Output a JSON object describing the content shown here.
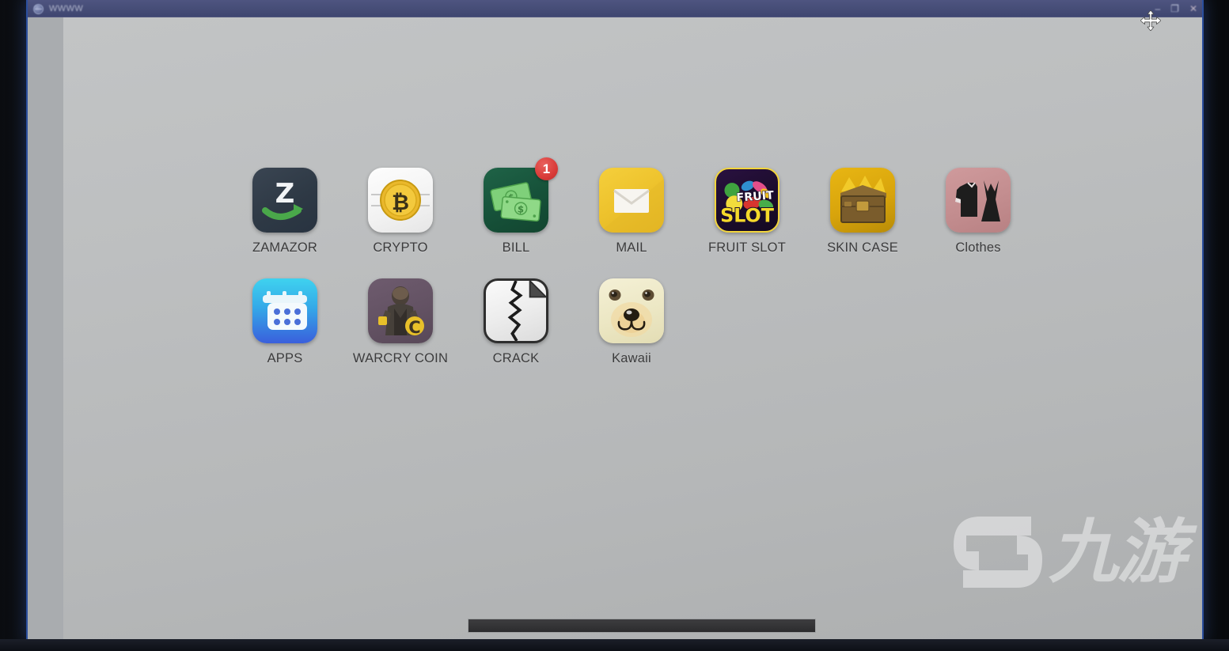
{
  "window": {
    "title": "WWWW",
    "favicon": "browser-globe-icon",
    "controls": {
      "minimize": "–",
      "maximize": "❐",
      "close": "✕"
    }
  },
  "cursor": {
    "type": "move-cursor"
  },
  "desktop": {
    "apps": [
      {
        "id": "zamazor",
        "label": "ZAMAZOR",
        "icon": "zamazor-icon",
        "badge": null
      },
      {
        "id": "crypto",
        "label": "CRYPTO",
        "icon": "crypto-icon",
        "badge": null
      },
      {
        "id": "bill",
        "label": "BILL",
        "icon": "bill-icon",
        "badge": "1"
      },
      {
        "id": "mail",
        "label": "MAIL",
        "icon": "mail-icon",
        "badge": null
      },
      {
        "id": "fruit-slot",
        "label": "FRUIT SLOT",
        "icon": "fruit-slot-icon",
        "badge": null
      },
      {
        "id": "skin-case",
        "label": "SKIN CASE",
        "icon": "skin-case-icon",
        "badge": null
      },
      {
        "id": "clothes",
        "label": "Clothes",
        "icon": "clothes-icon",
        "badge": null
      },
      {
        "id": "apps",
        "label": "APPS",
        "icon": "apps-icon",
        "badge": null
      },
      {
        "id": "warcry-coin",
        "label": "WARCRY COIN",
        "icon": "warcry-coin-icon",
        "badge": null
      },
      {
        "id": "crack",
        "label": "CRACK",
        "icon": "crack-icon",
        "badge": null
      },
      {
        "id": "kawaii",
        "label": "Kawaii",
        "icon": "kawaii-icon",
        "badge": null
      }
    ]
  },
  "icon_art": {
    "fruit_slot_top_text": "FRUIT",
    "fruit_slot_bottom_text": "SLOT",
    "zamazor_letter": "Z",
    "crypto_symbol": "₿",
    "warcry_symbol": "C",
    "bill_symbol": "$"
  },
  "watermark": {
    "text": "九游",
    "logo": "g-logo-icon"
  },
  "colors": {
    "titlebar": "#474e78",
    "window_border": "#2b4f9e",
    "page_background": "#bdbfc0",
    "label_text": "#3b3b3c",
    "badge_red": "#d93b38",
    "scrollbar_thumb": "#343436"
  }
}
